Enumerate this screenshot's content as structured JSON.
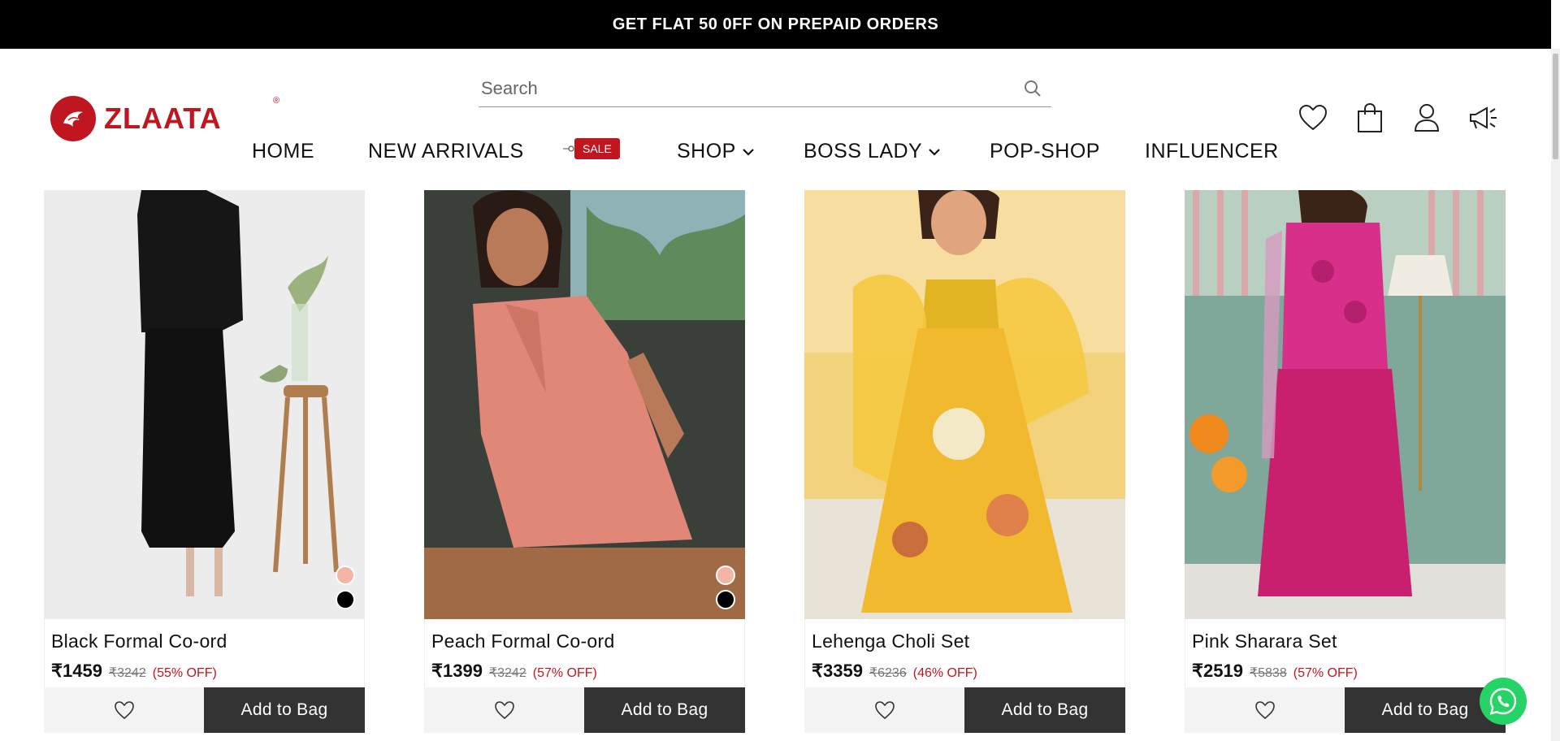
{
  "announcement": "GET FLAT 50 0FF ON PREPAID ORDERS",
  "brand": {
    "name": "ZLAATA",
    "registered": "®",
    "color": "#c0161f"
  },
  "search": {
    "placeholder": "Search",
    "value": ""
  },
  "nav": {
    "items": [
      {
        "label": "HOME",
        "dropdown": false
      },
      {
        "label": "NEW ARRIVALS",
        "dropdown": false
      },
      {
        "label": "SALE",
        "type": "tag"
      },
      {
        "label": "SHOP",
        "dropdown": true
      },
      {
        "label": "BOSS LADY",
        "dropdown": true
      },
      {
        "label": "POP-SHOP",
        "dropdown": false
      },
      {
        "label": "INFLUENCER",
        "dropdown": false
      }
    ]
  },
  "header_icons": [
    "heart-icon",
    "shopping-bag-icon",
    "user-icon",
    "megaphone-icon"
  ],
  "products": [
    {
      "name": "Black Formal Co-ord",
      "price": "₹1459",
      "mrp": "₹3242",
      "off": "(55% OFF)",
      "add_label": "Add to Bag",
      "swatches": [
        "#f4b5a4",
        "#000000"
      ]
    },
    {
      "name": "Peach Formal Co-ord",
      "price": "₹1399",
      "mrp": "₹3242",
      "off": "(57% OFF)",
      "add_label": "Add to Bag",
      "swatches": [
        "#f4b5a4",
        "#000000"
      ]
    },
    {
      "name": "Lehenga Choli Set",
      "price": "₹3359",
      "mrp": "₹6236",
      "off": "(46% OFF)",
      "add_label": "Add to Bag",
      "swatches": []
    },
    {
      "name": "Pink Sharara Set",
      "price": "₹2519",
      "mrp": "₹5838",
      "off": "(57% OFF)",
      "add_label": "Add to Bag",
      "swatches": []
    }
  ],
  "colors": {
    "accent": "#c0161f",
    "button_dark": "#333333",
    "whatsapp": "#25d366"
  }
}
